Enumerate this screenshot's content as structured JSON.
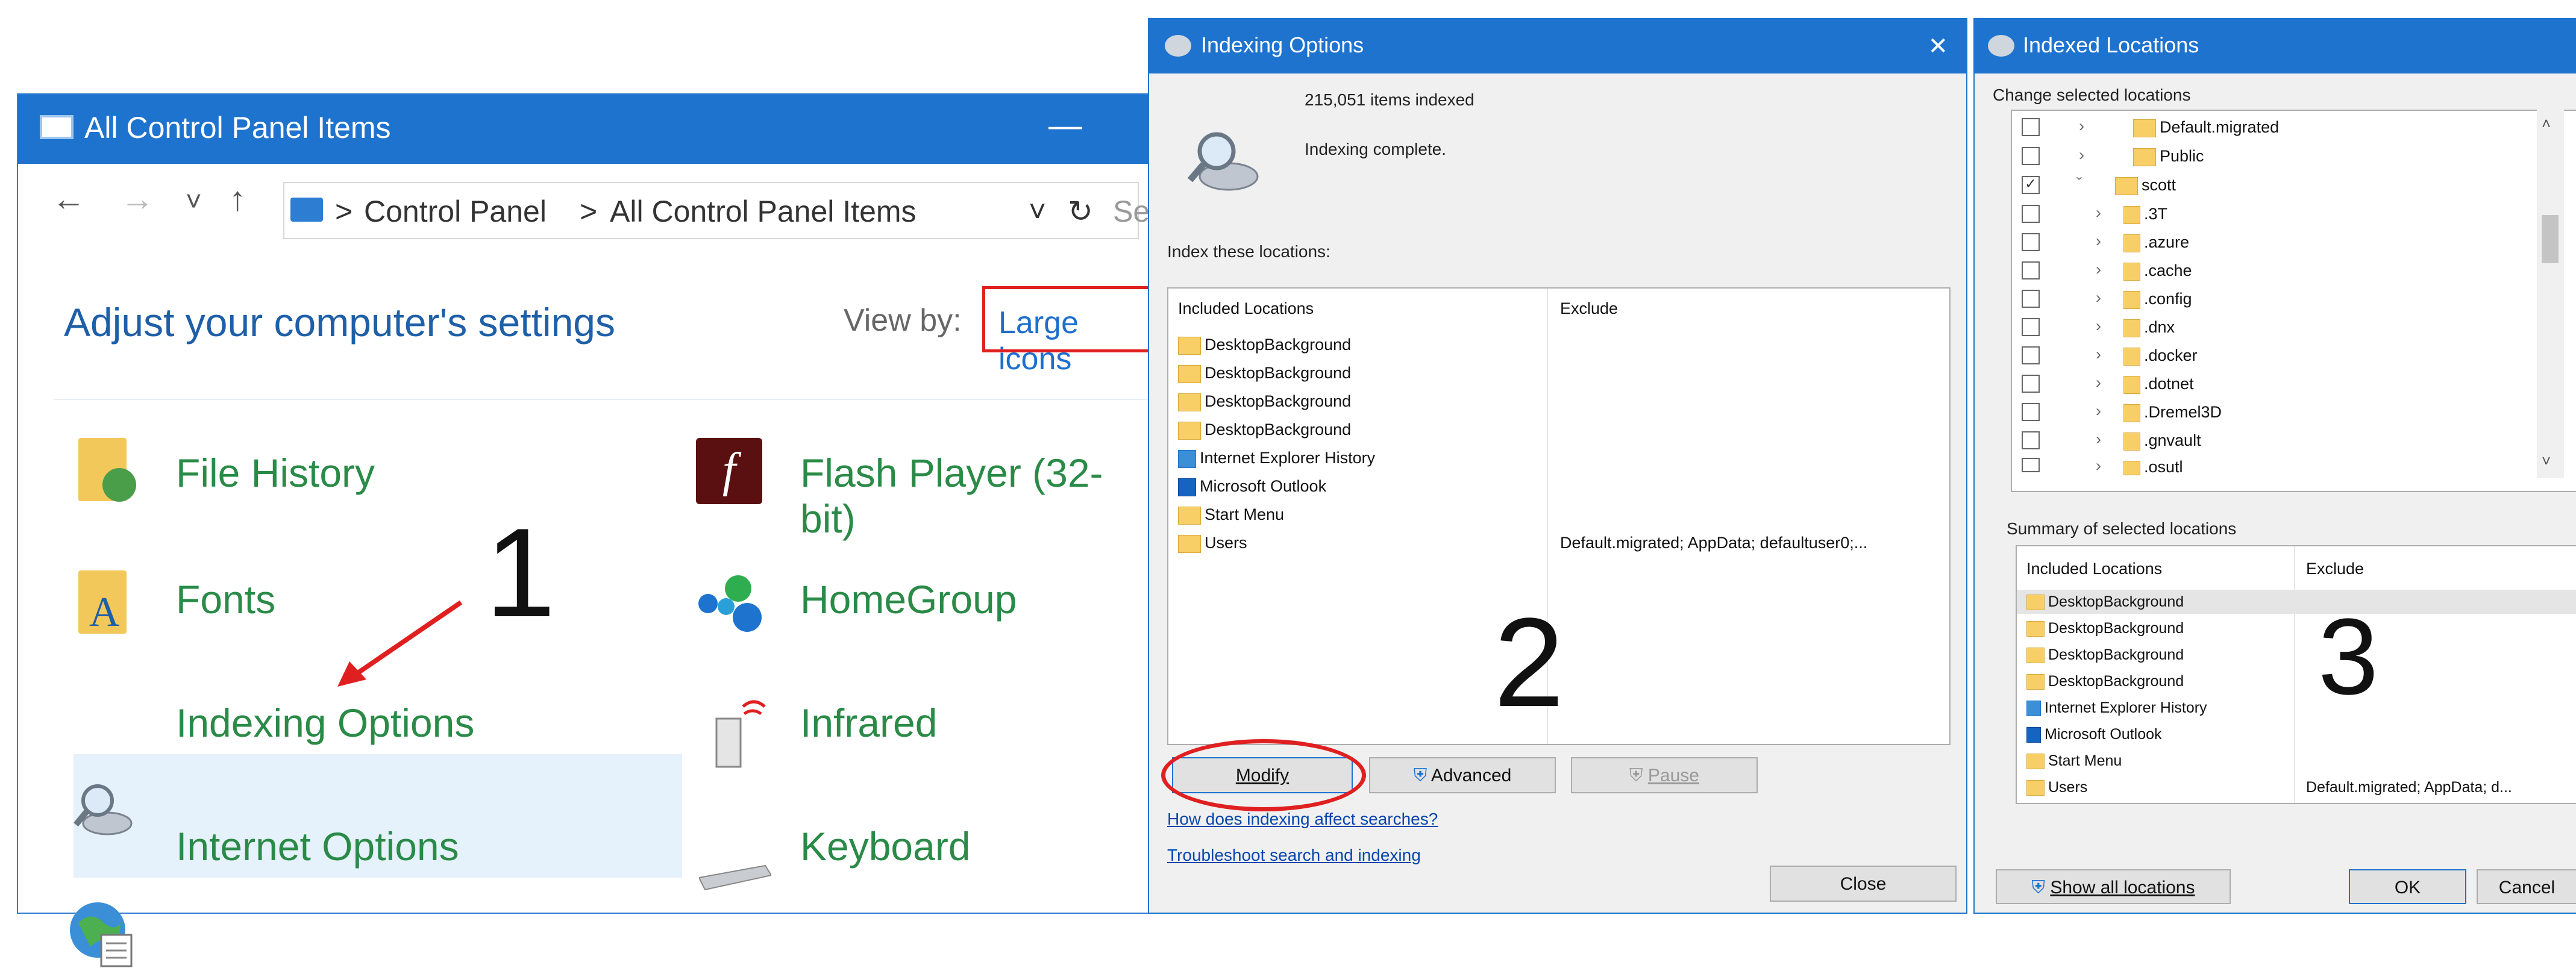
{
  "control_panel": {
    "title": "All Control Panel Items",
    "minimize": "—",
    "nav": {
      "back": "←",
      "forward": "→",
      "recent": "˅",
      "up": "↑"
    },
    "breadcrumb": [
      ">",
      "Control Panel",
      ">",
      "All Control Panel Items"
    ],
    "address_dropdown": "˅",
    "refresh": "↻",
    "search_placeholder": "Se",
    "heading": "Adjust your computer's settings",
    "view_by_label": "View by:",
    "view_by_value": "Large icons",
    "items_left": [
      "File History",
      "Fonts",
      "Indexing Options",
      "Internet Options"
    ],
    "items_right": [
      "Flash Player (32-bit)",
      "HomeGroup",
      "Infrared",
      "Keyboard"
    ],
    "flash_glyph": "f",
    "fonts_glyph": "A"
  },
  "annotations": {
    "step1": "1",
    "step2": "2",
    "step3": "3"
  },
  "indexing_options": {
    "title": "Indexing Options",
    "close": "✕",
    "items_indexed": "215,051 items indexed",
    "status": "Indexing complete.",
    "index_label": "Index these locations:",
    "col_included": "Included Locations",
    "col_exclude": "Exclude",
    "locations": [
      "DesktopBackground",
      "DesktopBackground",
      "DesktopBackground",
      "DesktopBackground",
      "Internet Explorer History",
      "Microsoft Outlook",
      "Start Menu",
      "Users"
    ],
    "users_exclude": "Default.migrated; AppData; defaultuser0;...",
    "modify": "Modify",
    "advanced": "Advanced",
    "pause": "Pause",
    "link1": "How does indexing affect searches?",
    "link2": "Troubleshoot search and indexing",
    "close_button": "Close"
  },
  "indexed_locations": {
    "title": "Indexed Locations",
    "change_label": "Change selected locations",
    "tree": [
      {
        "label": "Default.migrated",
        "checked": false
      },
      {
        "label": "Public",
        "checked": false
      },
      {
        "label": "scott",
        "checked": true
      },
      {
        "label": ".3T",
        "checked": false
      },
      {
        "label": ".azure",
        "checked": false
      },
      {
        "label": ".cache",
        "checked": false
      },
      {
        "label": ".config",
        "checked": false
      },
      {
        "label": ".dnx",
        "checked": false
      },
      {
        "label": ".docker",
        "checked": false
      },
      {
        "label": ".dotnet",
        "checked": false
      },
      {
        "label": ".Dremel3D",
        "checked": false
      },
      {
        "label": ".gnvault",
        "checked": false
      },
      {
        "label": ".osutl",
        "checked": false
      }
    ],
    "scroll_up": "˄",
    "scroll_down": "˅",
    "summary_label": "Summary of selected locations",
    "col_included": "Included Locations",
    "col_exclude": "Exclude",
    "summary": [
      "DesktopBackground",
      "DesktopBackground",
      "DesktopBackground",
      "DesktopBackground",
      "Internet Explorer History",
      "Microsoft Outlook",
      "Start Menu",
      "Users"
    ],
    "users_exclude": "Default.migrated; AppData; d...",
    "show_all": "Show all locations",
    "ok": "OK",
    "cancel": "Cancel"
  },
  "colors": {
    "title_bar": "#1e73cf",
    "highlight": "#e5f1fb",
    "annotation_red": "#e02020",
    "item_green": "#2a8a47"
  }
}
